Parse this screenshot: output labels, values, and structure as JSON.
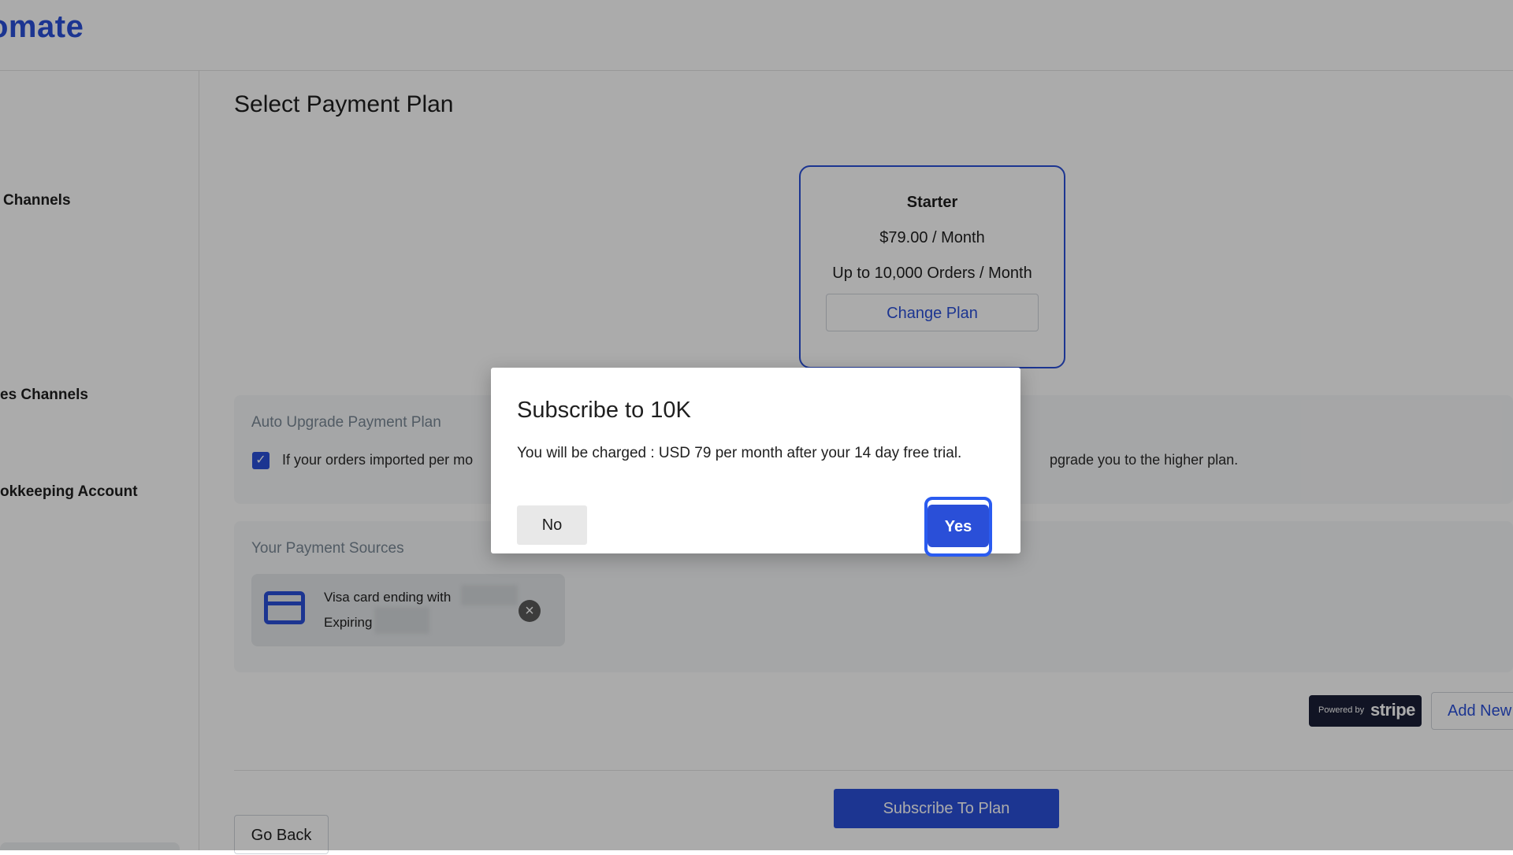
{
  "brand": {
    "logo_text": "omate",
    "accent_color": "#2a4fd8"
  },
  "sidebar": {
    "items": [
      {
        "label": "Channels"
      },
      {
        "label": "es Channels"
      },
      {
        "label": "okkeeping Account"
      }
    ]
  },
  "main": {
    "page_title": "Select Payment Plan",
    "plan": {
      "name": "Starter",
      "price": "$79.00 / Month",
      "orders": "Up to 10,000 Orders / Month",
      "change_label": "Change Plan"
    },
    "auto_upgrade": {
      "title": "Auto Upgrade Payment Plan",
      "checked": true,
      "text_left": "If your orders imported per mo",
      "text_right": "pgrade you to the higher plan."
    },
    "payment_sources": {
      "title": "Your Payment Sources",
      "card_label": "Visa card ending with",
      "expiring_label": "Expiring"
    },
    "stripe_badge": {
      "powered_by": "Powered by",
      "wordmark": "stripe"
    },
    "add_new_label": "Add New",
    "subscribe_label": "Subscribe To Plan",
    "go_back_label": "Go Back"
  },
  "modal": {
    "title": "Subscribe to 10K",
    "message": "You will be charged : USD 79 per month after your 14 day free trial.",
    "no_label": "No",
    "yes_label": "Yes"
  }
}
